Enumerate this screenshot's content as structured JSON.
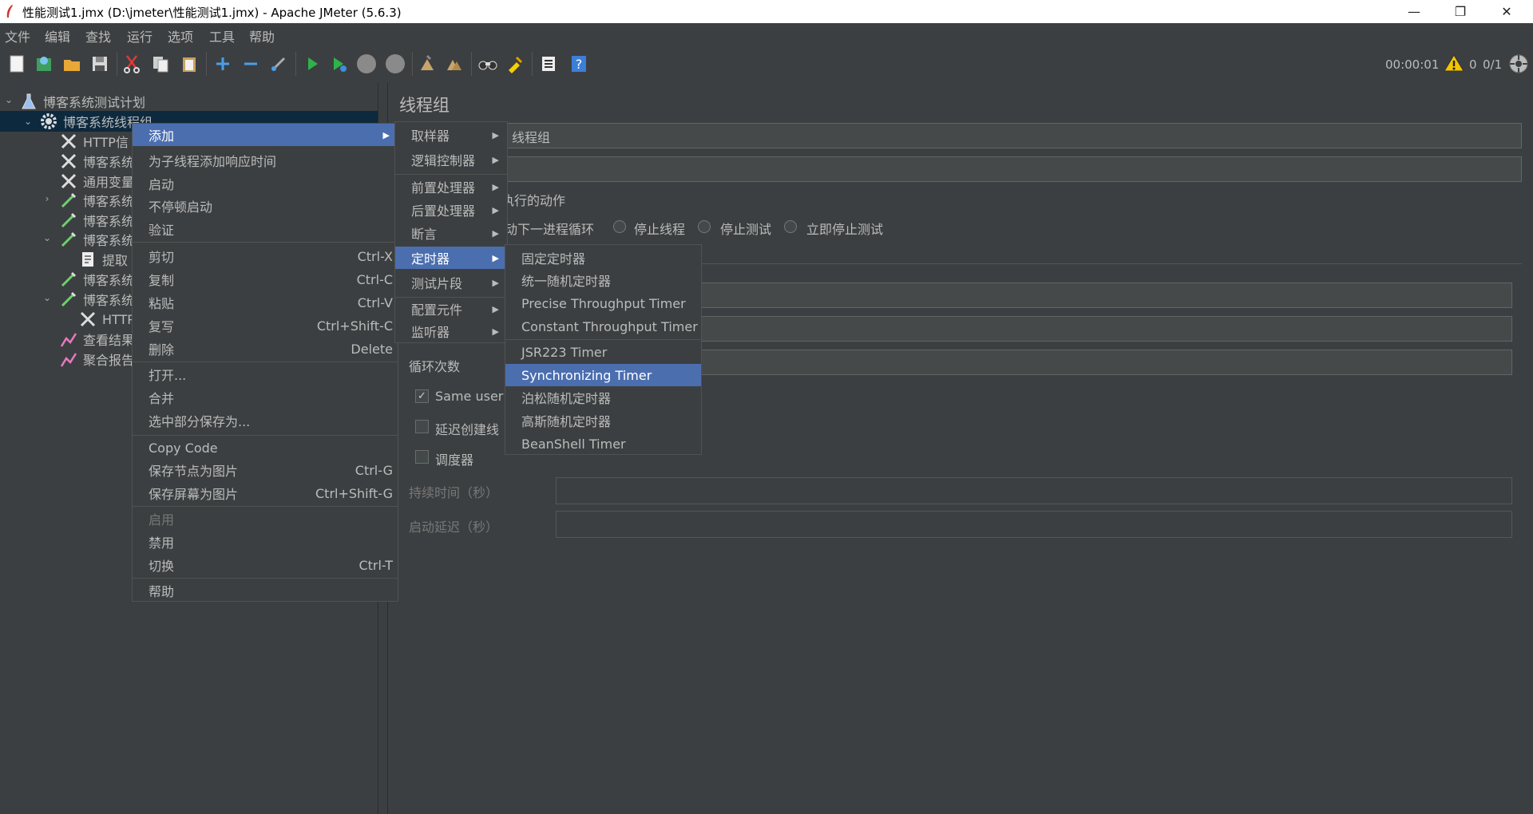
{
  "window": {
    "title": "性能测试1.jmx (D:\\jmeter\\性能测试1.jmx) - Apache JMeter (5.6.3)",
    "minimize": "—",
    "maximize": "❐",
    "close": "✕"
  },
  "menubar": [
    "文件",
    "编辑",
    "查找",
    "运行",
    "选项",
    "工具",
    "帮助"
  ],
  "toolbar": {
    "icons": [
      "new-icon",
      "templates-icon",
      "open-icon",
      "save-icon",
      "cut-icon",
      "copy-icon",
      "paste-icon",
      "expand-icon",
      "collapse-icon",
      "toggle-icon",
      "start-icon",
      "start-no-pause-icon",
      "stop-icon",
      "shutdown-icon",
      "clear-icon",
      "clear-all-icon",
      "search-icon",
      "reset-search-icon",
      "function-helper-icon",
      "help-icon"
    ],
    "elapsed": "00:00:01",
    "error_count": "0",
    "threads": "0/1"
  },
  "tree": {
    "nodes": [
      {
        "label": "博客系统测试计划",
        "icon": "test-plan-icon"
      },
      {
        "label": "博客系统线程组",
        "icon": "gear-icon"
      },
      {
        "label": "HTTP信",
        "icon": "wrench-icon"
      },
      {
        "label": "博客系统",
        "icon": "wrench-icon"
      },
      {
        "label": "通用变量",
        "icon": "wrench-icon"
      },
      {
        "label": "博客系统",
        "icon": "sampler-icon"
      },
      {
        "label": "博客系统",
        "icon": "sampler-icon"
      },
      {
        "label": "博客系统",
        "icon": "sampler-icon"
      },
      {
        "label": "提取",
        "icon": "extractor-icon"
      },
      {
        "label": "博客系统",
        "icon": "sampler-icon"
      },
      {
        "label": "博客系统",
        "icon": "sampler-icon"
      },
      {
        "label": "HTTP",
        "icon": "wrench-icon"
      },
      {
        "label": "查看结果",
        "icon": "listener-icon"
      },
      {
        "label": "聚合报告",
        "icon": "listener-icon"
      }
    ]
  },
  "content": {
    "heading": "线程组",
    "name_value": "线程组",
    "action_label": "执行的动作",
    "radio_options": [
      "动下一进程循环",
      "停止线程",
      "停止测试",
      "立即停止测试"
    ],
    "loop_label": "循环次数",
    "same_user_label": "Same user c",
    "delay_create_label": "延迟创建线",
    "scheduler_label": "调度器",
    "duration_label": "持续时间（秒）",
    "startup_delay_label": "启动延迟（秒）"
  },
  "context_menu": {
    "items": [
      {
        "label": "添加",
        "shortcut": "",
        "arrow": "▶"
      },
      {
        "label": "为子线程添加响应时间",
        "shortcut": ""
      },
      {
        "label": "启动",
        "shortcut": ""
      },
      {
        "label": "不停顿启动",
        "shortcut": ""
      },
      {
        "label": "验证",
        "shortcut": ""
      },
      {
        "label": "剪切",
        "shortcut": "Ctrl-X"
      },
      {
        "label": "复制",
        "shortcut": "Ctrl-C"
      },
      {
        "label": "粘贴",
        "shortcut": "Ctrl-V"
      },
      {
        "label": "复写",
        "shortcut": "Ctrl+Shift-C"
      },
      {
        "label": "删除",
        "shortcut": "Delete"
      },
      {
        "label": "打开...",
        "shortcut": ""
      },
      {
        "label": "合并",
        "shortcut": ""
      },
      {
        "label": "选中部分保存为...",
        "shortcut": ""
      },
      {
        "label": "Copy Code",
        "shortcut": ""
      },
      {
        "label": "保存节点为图片",
        "shortcut": "Ctrl-G"
      },
      {
        "label": "保存屏幕为图片",
        "shortcut": "Ctrl+Shift-G"
      },
      {
        "label": "启用",
        "shortcut": ""
      },
      {
        "label": "禁用",
        "shortcut": ""
      },
      {
        "label": "切换",
        "shortcut": "Ctrl-T"
      },
      {
        "label": "帮助",
        "shortcut": ""
      }
    ]
  },
  "add_submenu": {
    "arrow": "▶",
    "items": [
      "取样器",
      "逻辑控制器",
      "前置处理器",
      "后置处理器",
      "断言",
      "定时器",
      "测试片段",
      "配置元件",
      "监听器"
    ]
  },
  "timer_submenu": {
    "items": [
      "固定定时器",
      "统一随机定时器",
      "Precise Throughput Timer",
      "Constant Throughput Timer",
      "JSR223 Timer",
      "Synchronizing Timer",
      "泊松随机定时器",
      "高斯随机定时器",
      "BeanShell Timer"
    ]
  },
  "colors": {
    "background": "#3c3f41",
    "highlight": "#4b6eaf",
    "tree_selected": "#0d293e",
    "text": "#bbbbbb"
  }
}
